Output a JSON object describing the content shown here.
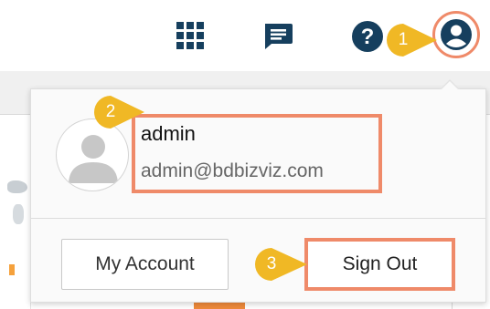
{
  "topbar": {
    "icons": [
      "apps-grid-icon",
      "chat-icon",
      "help-icon",
      "user-account-icon"
    ],
    "help_glyph": "?"
  },
  "menu": {
    "user": {
      "name": "admin",
      "email": "admin@bdbizviz.com",
      "avatar_icon": "user-avatar-icon"
    },
    "buttons": {
      "my_account": "My Account",
      "sign_out": "Sign Out"
    }
  },
  "annotations": {
    "step1": "1",
    "step2": "2",
    "step3": "3"
  },
  "colors": {
    "accent_navy": "#163f5e",
    "highlight_orange": "#ef8a69",
    "marker_yellow": "#f0b825"
  }
}
